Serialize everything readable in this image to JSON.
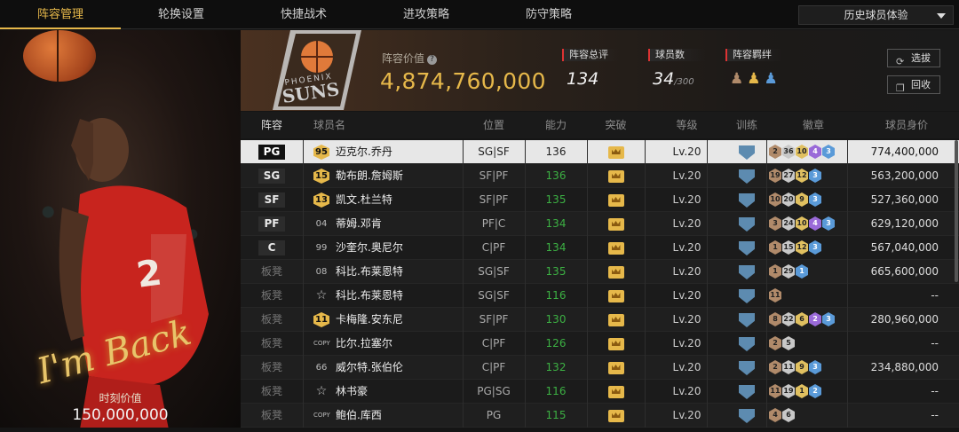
{
  "nav": {
    "tabs": [
      {
        "label": "阵容管理"
      },
      {
        "label": "轮换设置"
      },
      {
        "label": "快捷战术"
      },
      {
        "label": "进攻策略"
      },
      {
        "label": "防守策略"
      }
    ],
    "active_tab": 0,
    "dropdown_label": "历史球员体验"
  },
  "featured": {
    "signature": "I'm Back",
    "value_label": "时刻价值",
    "value": "150,000,000"
  },
  "header": {
    "team_logo_text": "PHOENIX SUNS",
    "lineup_value_label": "阵容价值",
    "lineup_value": "4,874,760,000",
    "overall_label": "阵容总评",
    "overall_value": "134",
    "players_label": "球员数",
    "players_value": "34",
    "players_max": "/300",
    "bond_label": "阵容羁绊",
    "select_label": "选拔",
    "recycle_label": "回收"
  },
  "table": {
    "headers": {
      "lineup": "阵容",
      "name": "球员名",
      "position": "位置",
      "ability": "能力",
      "breakthrough": "突破",
      "level": "等级",
      "training": "训练",
      "badges": "徽章",
      "value": "球员身价"
    },
    "rows": [
      {
        "slot": "PG",
        "rating": "95",
        "rating_type": "gold",
        "name": "迈克尔.乔丹",
        "position": "SG|SF",
        "ability": "136",
        "level": "Lv.20",
        "badges": [
          [
            "br",
            "2"
          ],
          [
            "si",
            "36"
          ],
          [
            "go",
            "10"
          ],
          [
            "pu",
            "4"
          ],
          [
            "bl",
            "3"
          ]
        ],
        "value": "774,400,000",
        "selected": true
      },
      {
        "slot": "SG",
        "rating": "15",
        "rating_type": "gold",
        "name": "勒布朗.詹姆斯",
        "position": "SF|PF",
        "ability": "136",
        "level": "Lv.20",
        "badges": [
          [
            "br",
            "19"
          ],
          [
            "si",
            "27"
          ],
          [
            "go",
            "12"
          ],
          [
            "bl",
            "3"
          ]
        ],
        "value": "563,200,000"
      },
      {
        "slot": "SF",
        "rating": "13",
        "rating_type": "gold",
        "name": "凯文.杜兰特",
        "position": "SF|PF",
        "ability": "135",
        "level": "Lv.20",
        "badges": [
          [
            "br",
            "10"
          ],
          [
            "si",
            "20"
          ],
          [
            "go",
            "9"
          ],
          [
            "bl",
            "3"
          ]
        ],
        "value": "527,360,000"
      },
      {
        "slot": "PF",
        "rating": "04",
        "rating_type": "plain",
        "name": "蒂姆.邓肯",
        "position": "PF|C",
        "ability": "134",
        "level": "Lv.20",
        "badges": [
          [
            "br",
            "3"
          ],
          [
            "si",
            "24"
          ],
          [
            "go",
            "10"
          ],
          [
            "pu",
            "4"
          ],
          [
            "bl",
            "3"
          ]
        ],
        "value": "629,120,000"
      },
      {
        "slot": "C",
        "rating": "99",
        "rating_type": "plain",
        "name": "沙奎尔.奥尼尔",
        "position": "C|PF",
        "ability": "134",
        "level": "Lv.20",
        "badges": [
          [
            "br",
            "1"
          ],
          [
            "si",
            "15"
          ],
          [
            "go",
            "12"
          ],
          [
            "bl",
            "3"
          ]
        ],
        "value": "567,040,000"
      },
      {
        "slot": "板凳",
        "rating": "08",
        "rating_type": "plain",
        "name": "科比.布莱恩特",
        "position": "SG|SF",
        "ability": "135",
        "level": "Lv.20",
        "badges": [
          [
            "br",
            "1"
          ],
          [
            "si",
            "29"
          ],
          [
            "bl",
            "1"
          ]
        ],
        "value": "665,600,000"
      },
      {
        "slot": "板凳",
        "rating": "☆",
        "rating_type": "star",
        "name": "科比.布莱恩特",
        "position": "SG|SF",
        "ability": "116",
        "level": "Lv.20",
        "badges": [
          [
            "br",
            "11"
          ]
        ],
        "value": "--"
      },
      {
        "slot": "板凳",
        "rating": "11",
        "rating_type": "gold",
        "name": "卡梅隆.安东尼",
        "position": "SF|PF",
        "ability": "130",
        "level": "Lv.20",
        "badges": [
          [
            "br",
            "8"
          ],
          [
            "si",
            "22"
          ],
          [
            "go",
            "6"
          ],
          [
            "pu",
            "2"
          ],
          [
            "bl",
            "3"
          ]
        ],
        "value": "280,960,000"
      },
      {
        "slot": "板凳",
        "rating": "COPY",
        "rating_type": "copy",
        "name": "比尔.拉塞尔",
        "position": "C|PF",
        "ability": "126",
        "level": "Lv.20",
        "badges": [
          [
            "br",
            "2"
          ],
          [
            "si",
            "5"
          ]
        ],
        "value": "--"
      },
      {
        "slot": "板凳",
        "rating": "66",
        "rating_type": "plain",
        "name": "威尔特.张伯伦",
        "position": "C|PF",
        "ability": "132",
        "level": "Lv.20",
        "badges": [
          [
            "br",
            "2"
          ],
          [
            "si",
            "11"
          ],
          [
            "go",
            "9"
          ],
          [
            "bl",
            "3"
          ]
        ],
        "value": "234,880,000"
      },
      {
        "slot": "板凳",
        "rating": "☆",
        "rating_type": "star",
        "name": "林书豪",
        "position": "PG|SG",
        "ability": "116",
        "level": "Lv.20",
        "badges": [
          [
            "br",
            "11"
          ],
          [
            "si",
            "19"
          ],
          [
            "go",
            "1"
          ],
          [
            "bl",
            "2"
          ]
        ],
        "value": "--"
      },
      {
        "slot": "板凳",
        "rating": "COPY",
        "rating_type": "copy",
        "name": "鲍伯.库西",
        "position": "PG",
        "ability": "115",
        "level": "Lv.20",
        "badges": [
          [
            "br",
            "4"
          ],
          [
            "si",
            "6"
          ]
        ],
        "value": "--"
      }
    ]
  },
  "colors": {
    "accent": "#e6b84a",
    "ability_green": "#3cb043",
    "selected_row": "#e7e7e7"
  }
}
